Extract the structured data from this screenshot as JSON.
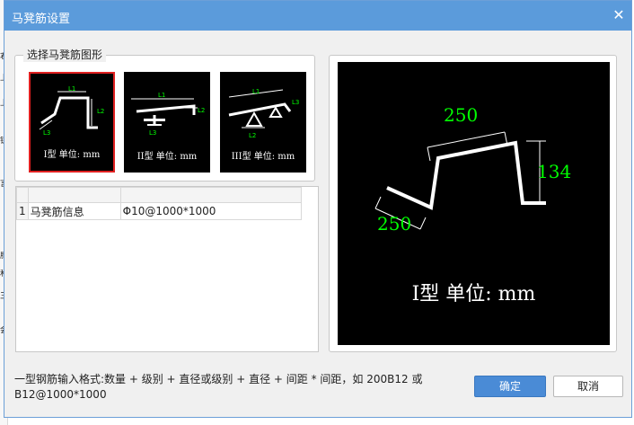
{
  "dialog": {
    "title": "马凳筋设置",
    "close_glyph": "✕"
  },
  "shape_group": {
    "label": "选择马凳筋图形",
    "shapes": [
      {
        "caption": "I型  单位: mm",
        "dim_labels": [
          "L1",
          "L2",
          "L3"
        ],
        "selected": true
      },
      {
        "caption": "II型  单位: mm",
        "dim_labels": [
          "L1",
          "L2",
          "L3"
        ],
        "selected": false
      },
      {
        "caption": "III型  单位: mm",
        "dim_labels": [
          "L1",
          "L2",
          "L3"
        ],
        "selected": false
      }
    ]
  },
  "grid": {
    "rows": [
      {
        "num": "1",
        "label": "马凳筋信息",
        "value": "Φ10@1000*1000"
      }
    ]
  },
  "preview": {
    "caption": "I型  单位: mm",
    "dims": {
      "top": "250",
      "right": "134",
      "left": "250"
    },
    "colors": {
      "shape": "#ffffff",
      "dimension_text": "#00ff00"
    }
  },
  "hint": "一型钢筋输入格式:数量 + 级别 + 直径或级别 + 直径 + 间距 * 间距，如 200B12 或 B12@1000*1000",
  "buttons": {
    "ok": "确定",
    "cancel": "取消"
  },
  "colors": {
    "titlebar": "#5b9bdb",
    "ok_button": "#4a8bd6",
    "selected_border": "#e02020"
  }
}
